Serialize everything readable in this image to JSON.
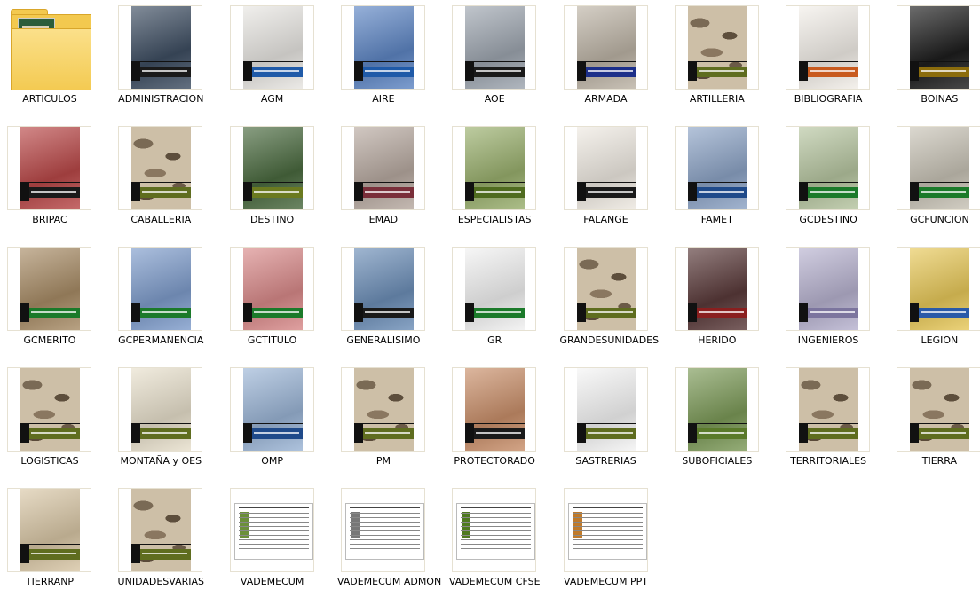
{
  "items": [
    {
      "label": "ARTICULOS",
      "icon": "folder-icon",
      "kind": "folder",
      "color": "#f3c94f"
    },
    {
      "label": "ADMINISTRACION",
      "icon": "document-cover-icon",
      "kind": "cover",
      "color": "#3e4e62",
      "band": "#1a1a1a"
    },
    {
      "label": "AGM",
      "icon": "document-cover-icon",
      "kind": "cover",
      "color": "#e8e6e2",
      "band": "#1f5aa8"
    },
    {
      "label": "AIRE",
      "icon": "document-cover-icon",
      "kind": "cover",
      "color": "#5e86c4",
      "band": "#1f5aa8"
    },
    {
      "label": "AOE",
      "icon": "document-cover-icon",
      "kind": "cover",
      "color": "#9ea6b0",
      "band": "#1a1a1a"
    },
    {
      "label": "ARMADA",
      "icon": "document-cover-icon",
      "kind": "cover",
      "color": "#bdb4a6",
      "band": "#1c2f8a"
    },
    {
      "label": "ARTILLERIA",
      "icon": "document-cover-icon",
      "kind": "camo",
      "color": "#cdbfa7",
      "band": "#5f6d1f"
    },
    {
      "label": "BIBLIOGRAFIA",
      "icon": "document-cover-icon",
      "kind": "cover",
      "color": "#f3efe9",
      "band": "#c85a1e"
    },
    {
      "label": "BOINAS",
      "icon": "document-cover-icon",
      "kind": "cover",
      "color": "#1d1d1d",
      "band": "#8b6c0c"
    },
    {
      "label": "BRIPAC",
      "icon": "document-cover-icon",
      "kind": "cover",
      "color": "#b94848",
      "band": "#1a1a1a"
    },
    {
      "label": "CABALLERIA",
      "icon": "document-cover-icon",
      "kind": "camo",
      "color": "#cdbfa7",
      "band": "#5f6d1f"
    },
    {
      "label": "DESTINO",
      "icon": "document-cover-icon",
      "kind": "cover",
      "color": "#4a6a3f",
      "band": "#6b7a20"
    },
    {
      "label": "EMAD",
      "icon": "document-cover-icon",
      "kind": "cover",
      "color": "#b8aaa1",
      "band": "#7a2f3a"
    },
    {
      "label": "ESPECIALISTAS",
      "icon": "document-cover-icon",
      "kind": "cover",
      "color": "#9ab06e",
      "band": "#4f6b1f"
    },
    {
      "label": "FALANGE",
      "icon": "document-cover-icon",
      "kind": "cover",
      "color": "#efeae2",
      "band": "#1a1a1a"
    },
    {
      "label": "FAMET",
      "icon": "document-cover-icon",
      "kind": "cover",
      "color": "#8da4c6",
      "band": "#1f4a8a"
    },
    {
      "label": "GCDESTINO",
      "icon": "document-cover-icon",
      "kind": "cover",
      "color": "#b7c6a1",
      "band": "#1b7a2a"
    },
    {
      "label": "GCFUNCION",
      "icon": "document-cover-icon",
      "kind": "cover",
      "color": "#c8c3b6",
      "band": "#1b7a2a"
    },
    {
      "label": "GCMERITO",
      "icon": "document-cover-icon",
      "kind": "cover",
      "color": "#a88c66",
      "band": "#1b7a2a"
    },
    {
      "label": "GCPERMANENCIA",
      "icon": "document-cover-icon",
      "kind": "cover",
      "color": "#7f9dcc",
      "band": "#1b7a2a"
    },
    {
      "label": "GCTITULO",
      "icon": "document-cover-icon",
      "kind": "cover",
      "color": "#d98a8a",
      "band": "#1b7a2a"
    },
    {
      "label": "GENERALISIMO",
      "icon": "document-cover-icon",
      "kind": "cover",
      "color": "#6d8fb8",
      "band": "#1a1a1a"
    },
    {
      "label": "GR",
      "icon": "document-cover-icon",
      "kind": "cover",
      "color": "#f2f2f2",
      "band": "#1b7a2a"
    },
    {
      "label": "GRANDESUNIDADES",
      "icon": "document-cover-icon",
      "kind": "camo",
      "color": "#cdbfa7",
      "band": "#5f6d1f"
    },
    {
      "label": "HERIDO",
      "icon": "document-cover-icon",
      "kind": "cover",
      "color": "#5a3a3a",
      "band": "#8a1f1f"
    },
    {
      "label": "INGENIEROS",
      "icon": "document-cover-icon",
      "kind": "cover",
      "color": "#b8b3d0",
      "band": "#7c759e"
    },
    {
      "label": "LEGION",
      "icon": "document-cover-icon",
      "kind": "cover",
      "color": "#e8c95a",
      "band": "#2a5aa8"
    },
    {
      "label": "LOGISTICAS",
      "icon": "document-cover-icon",
      "kind": "camo",
      "color": "#cdbfa7",
      "band": "#5f6d1f"
    },
    {
      "label": "MONTAÑA y OES",
      "icon": "document-cover-icon",
      "kind": "cover",
      "color": "#e8e0cc",
      "band": "#5f6d1f"
    },
    {
      "label": "OMP",
      "icon": "document-cover-icon",
      "kind": "cover",
      "color": "#9bb5d6",
      "band": "#1f4a8a"
    },
    {
      "label": "PM",
      "icon": "document-cover-icon",
      "kind": "camo",
      "color": "#cdbfa7",
      "band": "#5f6d1f"
    },
    {
      "label": "PROTECTORADO",
      "icon": "document-cover-icon",
      "kind": "cover",
      "color": "#c98f6a",
      "band": "#1a1a1a"
    },
    {
      "label": "SASTRERIAS",
      "icon": "document-cover-icon",
      "kind": "cover",
      "color": "#f5f5f5",
      "band": "#5f6d1f"
    },
    {
      "label": "SUBOFICIALES",
      "icon": "document-cover-icon",
      "kind": "cover",
      "color": "#7c9a58",
      "band": "#5a7a2a"
    },
    {
      "label": "TERRITORIALES",
      "icon": "document-cover-icon",
      "kind": "camo",
      "color": "#cdbfa7",
      "band": "#5f6d1f"
    },
    {
      "label": "TIERRA",
      "icon": "document-cover-icon",
      "kind": "camo",
      "color": "#cdbfa7",
      "band": "#5f6d1f"
    },
    {
      "label": "TIERRANP",
      "icon": "document-cover-icon",
      "kind": "cover",
      "color": "#d9c7a6",
      "band": "#5f6d1f"
    },
    {
      "label": "UNIDADESVARIAS",
      "icon": "document-cover-icon",
      "kind": "camo",
      "color": "#cdbfa7",
      "band": "#5f6d1f"
    },
    {
      "label": "VADEMECUM",
      "icon": "spreadsheet-icon",
      "kind": "sheet",
      "color": "#6b8f3a"
    },
    {
      "label": "VADEMECUM ADMON",
      "icon": "spreadsheet-icon",
      "kind": "sheet",
      "color": "#777777"
    },
    {
      "label": "VADEMECUM CFSE",
      "icon": "spreadsheet-icon",
      "kind": "sheet",
      "color": "#4f7a1f"
    },
    {
      "label": "VADEMECUM PPT",
      "icon": "spreadsheet-icon",
      "kind": "sheet",
      "color": "#c07a2a"
    }
  ]
}
